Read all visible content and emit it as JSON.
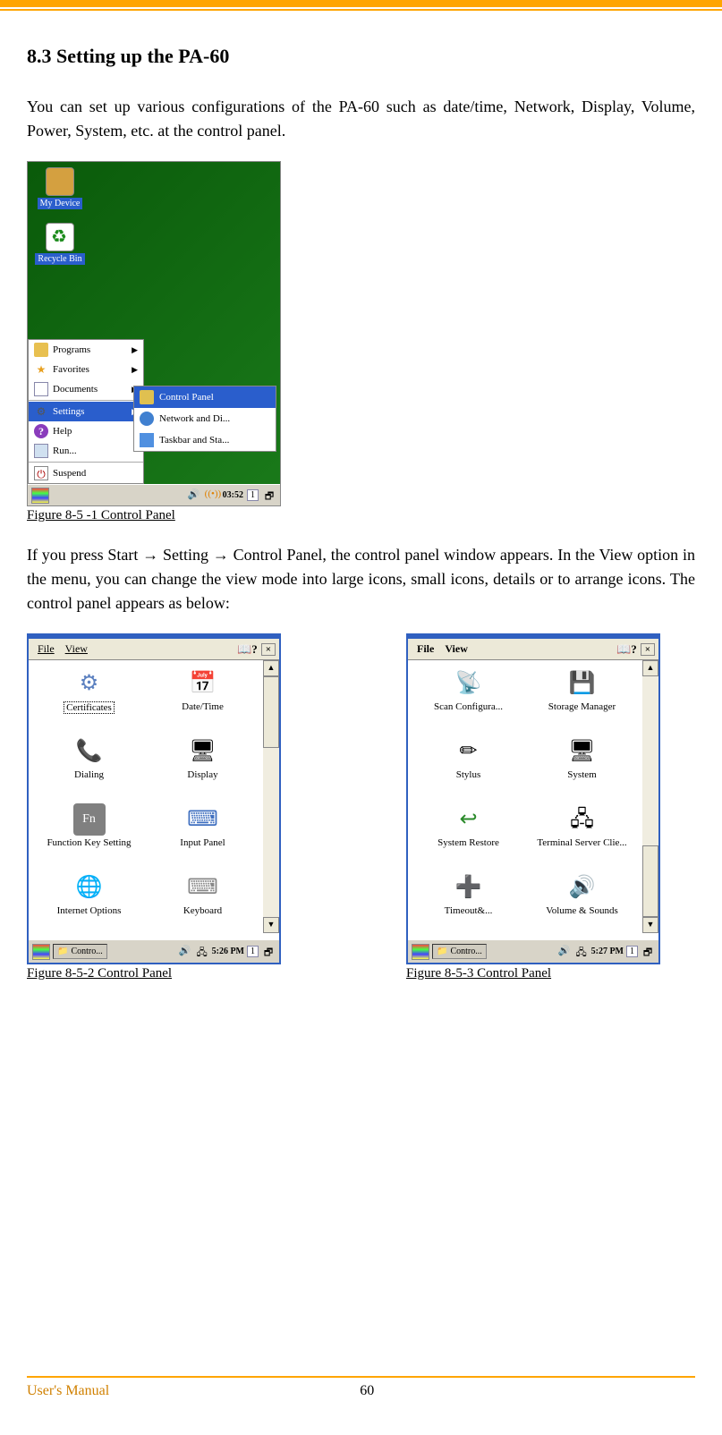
{
  "section": {
    "number": "8.3",
    "title": "Setting up the PA-60"
  },
  "para1": "You can set up various configurations of the PA-60 such as date/time, Network, Display, Volume, Power, System, etc. at the control panel.",
  "para2": "If you press Start → Setting → Control Panel, the control panel window appears. In the View option in the menu, you can change the view mode into large icons, small icons, details or to arrange icons. The control panel appears as below:",
  "fig1": {
    "caption": "Figure 8-5 -1 Control Panel",
    "desktop": {
      "mydevice": "My Device",
      "recyclebin": "Recycle Bin"
    },
    "start_items": [
      "Programs",
      "Favorites",
      "Documents",
      "Settings",
      "Help",
      "Run...",
      "Suspend"
    ],
    "submenu": [
      "Control Panel",
      "Network and Di...",
      "Taskbar and Sta..."
    ],
    "taskbar": {
      "time": "03:52",
      "box": "1"
    }
  },
  "fig2": {
    "caption": "Figure 8-5-2 Control Panel",
    "menu": {
      "file": "File",
      "view": "View",
      "help": "?",
      "close": "×"
    },
    "items": [
      {
        "label": "Certificates",
        "selected": true,
        "icon": "⚙"
      },
      {
        "label": "Date/Time",
        "icon": "📅"
      },
      {
        "label": "Dialing",
        "icon": "📞"
      },
      {
        "label": "Display",
        "icon": "🖥"
      },
      {
        "label": "Function Key Setting",
        "icon": "Fn"
      },
      {
        "label": "Input Panel",
        "icon": "⌨"
      },
      {
        "label": "Internet Options",
        "icon": "🌐"
      },
      {
        "label": "Keyboard",
        "icon": "⌨"
      }
    ],
    "taskbar": {
      "app": "Contro...",
      "time": "5:26 PM",
      "box": "1"
    }
  },
  "fig3": {
    "caption": "Figure 8-5-3 Control Panel",
    "menu": {
      "file": "File",
      "view": "View",
      "help": "?",
      "close": "×"
    },
    "items": [
      {
        "label": "Scan Configura...",
        "icon": "📡"
      },
      {
        "label": "Storage Manager",
        "icon": "💾"
      },
      {
        "label": "Stylus",
        "icon": "✏"
      },
      {
        "label": "System",
        "icon": "🖥"
      },
      {
        "label": "System Restore",
        "icon": "↩"
      },
      {
        "label": "Terminal Server Clie...",
        "icon": "🖧"
      },
      {
        "label": "Timeout&...",
        "icon": "➕"
      },
      {
        "label": "Volume & Sounds",
        "icon": "🔊"
      }
    ],
    "taskbar": {
      "app": "Contro...",
      "time": "5:27 PM",
      "box": "1"
    }
  },
  "footer": {
    "label": "User's Manual",
    "page": "60"
  }
}
